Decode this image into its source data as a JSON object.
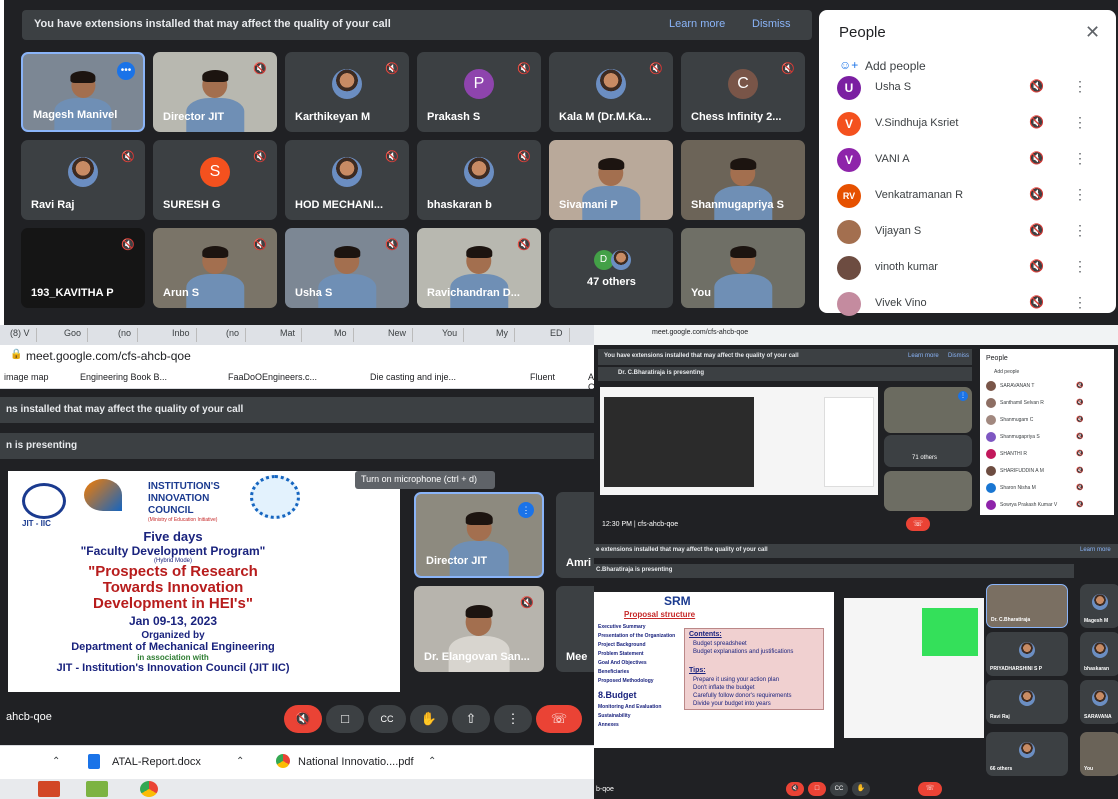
{
  "top_meet": {
    "banner": {
      "text": "You have extensions installed that may affect the quality of your call",
      "learn_more": "Learn more",
      "dismiss": "Dismiss"
    },
    "tiles": [
      {
        "name": "Magesh Manivel",
        "kind": "video"
      },
      {
        "name": "Director JIT",
        "kind": "video"
      },
      {
        "name": "Karthikeyan M",
        "kind": "photo"
      },
      {
        "name": "Prakash S",
        "kind": "letter",
        "letter": "P",
        "color": "#8e44ad"
      },
      {
        "name": "Kala M (Dr.M.Ka...",
        "kind": "photo"
      },
      {
        "name": "Chess Infinity 2...",
        "kind": "letter",
        "letter": "C",
        "color": "#795548"
      },
      {
        "name": "Ravi Raj",
        "kind": "photo"
      },
      {
        "name": "SURESH G",
        "kind": "letter",
        "letter": "S",
        "color": "#f4511e"
      },
      {
        "name": "HOD MECHANI...",
        "kind": "photo"
      },
      {
        "name": "bhaskaran b",
        "kind": "photo"
      },
      {
        "name": "Sivamani P",
        "kind": "video"
      },
      {
        "name": "Shanmugapriya S",
        "kind": "video"
      },
      {
        "name": "193_KAVITHA P",
        "kind": "dark"
      },
      {
        "name": "Arun S",
        "kind": "video"
      },
      {
        "name": "Usha S",
        "kind": "video"
      },
      {
        "name": "Ravichandran D...",
        "kind": "video"
      },
      {
        "name": "47 others",
        "kind": "others",
        "letter": "D"
      },
      {
        "name": "You",
        "kind": "video"
      }
    ],
    "people_panel": {
      "title": "People",
      "add_people": "Add people",
      "list": [
        {
          "name": "Usha S",
          "letter": "U",
          "color": "#7b1fa2"
        },
        {
          "name": "V.Sindhuja Ksriet",
          "letter": "V",
          "color": "#f4511e"
        },
        {
          "name": "VANI A",
          "letter": "V",
          "color": "#8e24aa"
        },
        {
          "name": "Venkatramanan R",
          "letter": "RV",
          "color": "#e65100"
        },
        {
          "name": "Vijayan S",
          "letter": "",
          "color": "#a36f4f"
        },
        {
          "name": "vinoth kumar",
          "letter": "",
          "color": "#6d4c41"
        },
        {
          "name": "Vivek Vino",
          "letter": "",
          "color": "#c48b9f"
        }
      ]
    }
  },
  "left_browser": {
    "tabs": [
      "(8) V",
      "Goo",
      "(no",
      "Inbo",
      "(no",
      "Mat",
      "Mo",
      "New",
      "You",
      "My",
      "ED"
    ],
    "url": "meet.google.com/cfs-ahcb-qoe",
    "bookmarks": [
      "image map",
      "Engineering Book B...",
      "FaaDoOEngineers.c...",
      "Die casting and inje...",
      "Fluent",
      "Alagappa Ch"
    ],
    "banner": "ns installed that may affect the quality of your call",
    "presenting": "n is presenting",
    "tooltip": "Turn on microphone (ctrl + d)",
    "slide": {
      "council_line1": "INSTITUTION'S",
      "council_line2": "INNOVATION",
      "council_line3": "COUNCIL",
      "ministry": "(Ministry of Education Initiative)",
      "jit": "JIT - IIC",
      "five_days": "Five days",
      "fdp": "\"Faculty Development Program\"",
      "hybrid": "(Hybrid Mode)",
      "title1": "\"Prospects of Research",
      "title2": "Towards Innovation",
      "title3": "Development in HEI's\"",
      "dates": "Jan 09-13, 2023",
      "organized": "Organized by",
      "dept": "Department of Mechanical Engineering",
      "assoc": "in association with",
      "jit_iic": "JIT - Institution's Innovation Council  (JIT IIC)"
    },
    "side_tiles": [
      {
        "name": "Director JIT"
      },
      {
        "name": "Amri"
      },
      {
        "name": "Dr. Elangovan San..."
      },
      {
        "name": "Mee"
      }
    ],
    "code": "ahcb-qoe",
    "downloads": [
      {
        "name": "ATAL-Report.docx"
      },
      {
        "name": "National Innovatio....pdf"
      }
    ]
  },
  "right_top": {
    "url": "meet.google.com/cfs-ahcb-qoe",
    "banner": "You have extensions installed that may affect the quality of your call",
    "learn_more": "Learn more",
    "dismiss": "Dismiss",
    "presenting": "Dr. C.Bharatiraja is presenting",
    "others": "71 others",
    "time": "12:30 PM  |  cfs-ahcb-qoe",
    "people_title": "People",
    "add_people": "Add people",
    "people": [
      "SARAVANAN T",
      "Santhamil Selvan R",
      "Shanmugam C",
      "Shanmugapriya S",
      "SHANTHI R",
      "SHARIFUDDIN A M",
      "Sharon Nisha M",
      "Sowrya Prakash Kumar V"
    ]
  },
  "right_bottom": {
    "banner": "e extensions installed that may affect the quality of your call",
    "learn_more": "Learn more",
    "presenting": "C.Bharatiraja is presenting",
    "code": "b-qoe",
    "slide": {
      "brand": "SRM",
      "heading": "Proposal structure",
      "left_list": [
        "Executive Summary",
        "Presentation of the Organization",
        "Project Background",
        "Problem Statement",
        "Goal And Objectives",
        "Beneficiaries",
        "Proposed Methodology"
      ],
      "budget_label": "8.Budget",
      "left_list2": [
        "Monitoring And Evaluation",
        "Sustainability",
        "Annexes"
      ],
      "contents_title": "Contents:",
      "contents": [
        "Budget spreadsheet",
        "Budget explanations and justifications"
      ],
      "tips_title": "Tips:",
      "tips": [
        "Prepare it using your action plan",
        "Don't inflate the budget",
        "Carefully follow donor's requirements",
        "Divide your budget into years"
      ]
    },
    "tiles": [
      {
        "name": "Dr. C.Bharatiraja"
      },
      {
        "name": "Magesh M"
      },
      {
        "name": "PRIYADHARSHINI S P"
      },
      {
        "name": "bhaskaran"
      },
      {
        "name": "Ravi Raj"
      },
      {
        "name": "SARAVANA"
      },
      {
        "name": "66 others"
      },
      {
        "name": "You"
      }
    ]
  },
  "colors": {
    "meet_bg": "#202124",
    "tile_bg": "#3c4043",
    "hangup": "#ea4335",
    "accent": "#8ab4f8"
  }
}
